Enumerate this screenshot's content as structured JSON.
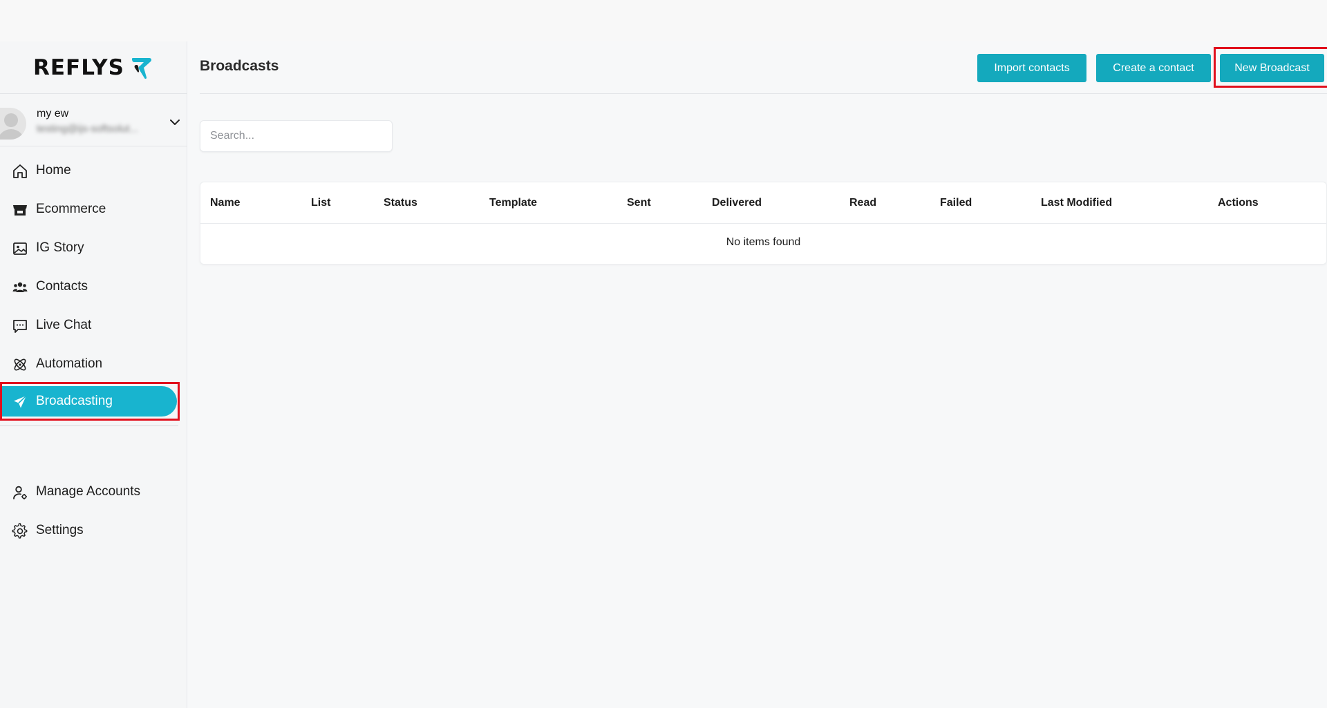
{
  "brand": {
    "name": "REFLYS",
    "accent_color": "#18b4cf"
  },
  "account": {
    "name": "my ew",
    "email_redacted": "testing@ijs-softsolut..."
  },
  "sidebar": {
    "items": [
      {
        "label": "Home",
        "icon": "home-icon"
      },
      {
        "label": "Ecommerce",
        "icon": "store-icon"
      },
      {
        "label": "IG Story",
        "icon": "image-icon"
      },
      {
        "label": "Contacts",
        "icon": "users-icon"
      },
      {
        "label": "Live Chat",
        "icon": "chat-icon"
      },
      {
        "label": "Automation",
        "icon": "atom-icon"
      },
      {
        "label": "Broadcasting",
        "icon": "send-icon",
        "active": true
      },
      {
        "label": "Manage Accounts",
        "icon": "user-gear-icon"
      },
      {
        "label": "Settings",
        "icon": "gear-icon"
      }
    ]
  },
  "header": {
    "title": "Broadcasts",
    "buttons": {
      "import_contacts": "Import contacts",
      "create_contact": "Create a contact",
      "new_broadcast": "New Broadcast"
    },
    "button_color": "#14a9bd"
  },
  "search": {
    "placeholder": "Search...",
    "value": ""
  },
  "table": {
    "columns": [
      "Name",
      "List",
      "Status",
      "Template",
      "Sent",
      "Delivered",
      "Read",
      "Failed",
      "Last Modified",
      "Actions"
    ],
    "empty_message": "No items found"
  },
  "annotations": {
    "highlight_color": "#e1101d"
  }
}
